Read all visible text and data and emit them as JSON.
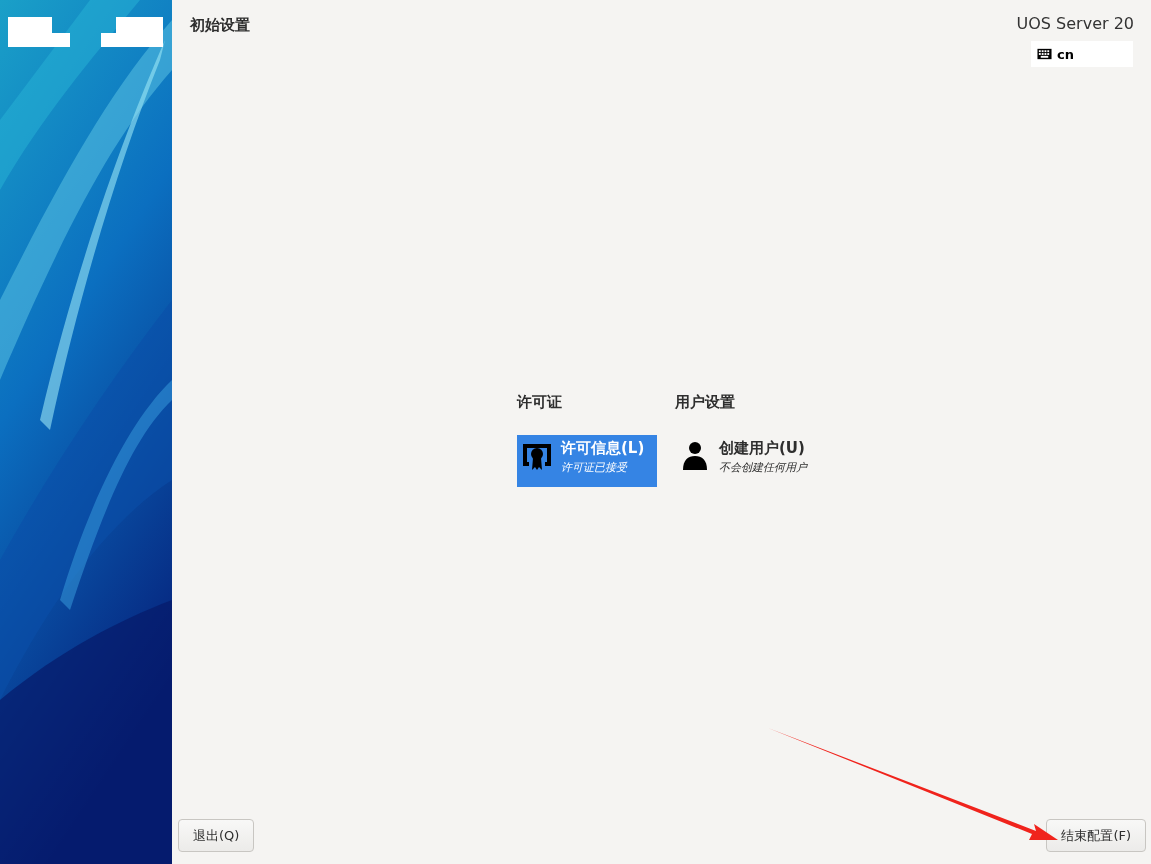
{
  "header": {
    "title": "初始设置",
    "product": "UOS Server 20",
    "keyboard_layout": "cn"
  },
  "categories": [
    {
      "title": "许可证",
      "spokes": [
        {
          "kind": "license",
          "title": "许可信息(L)",
          "status": "许可证已接受",
          "selected": true
        }
      ]
    },
    {
      "title": "用户设置",
      "spokes": [
        {
          "kind": "user",
          "title": "创建用户(U)",
          "status": "不会创建任何用户",
          "selected": false
        }
      ]
    }
  ],
  "buttons": {
    "quit": "退出(Q)",
    "finish": "结束配置(F)"
  }
}
